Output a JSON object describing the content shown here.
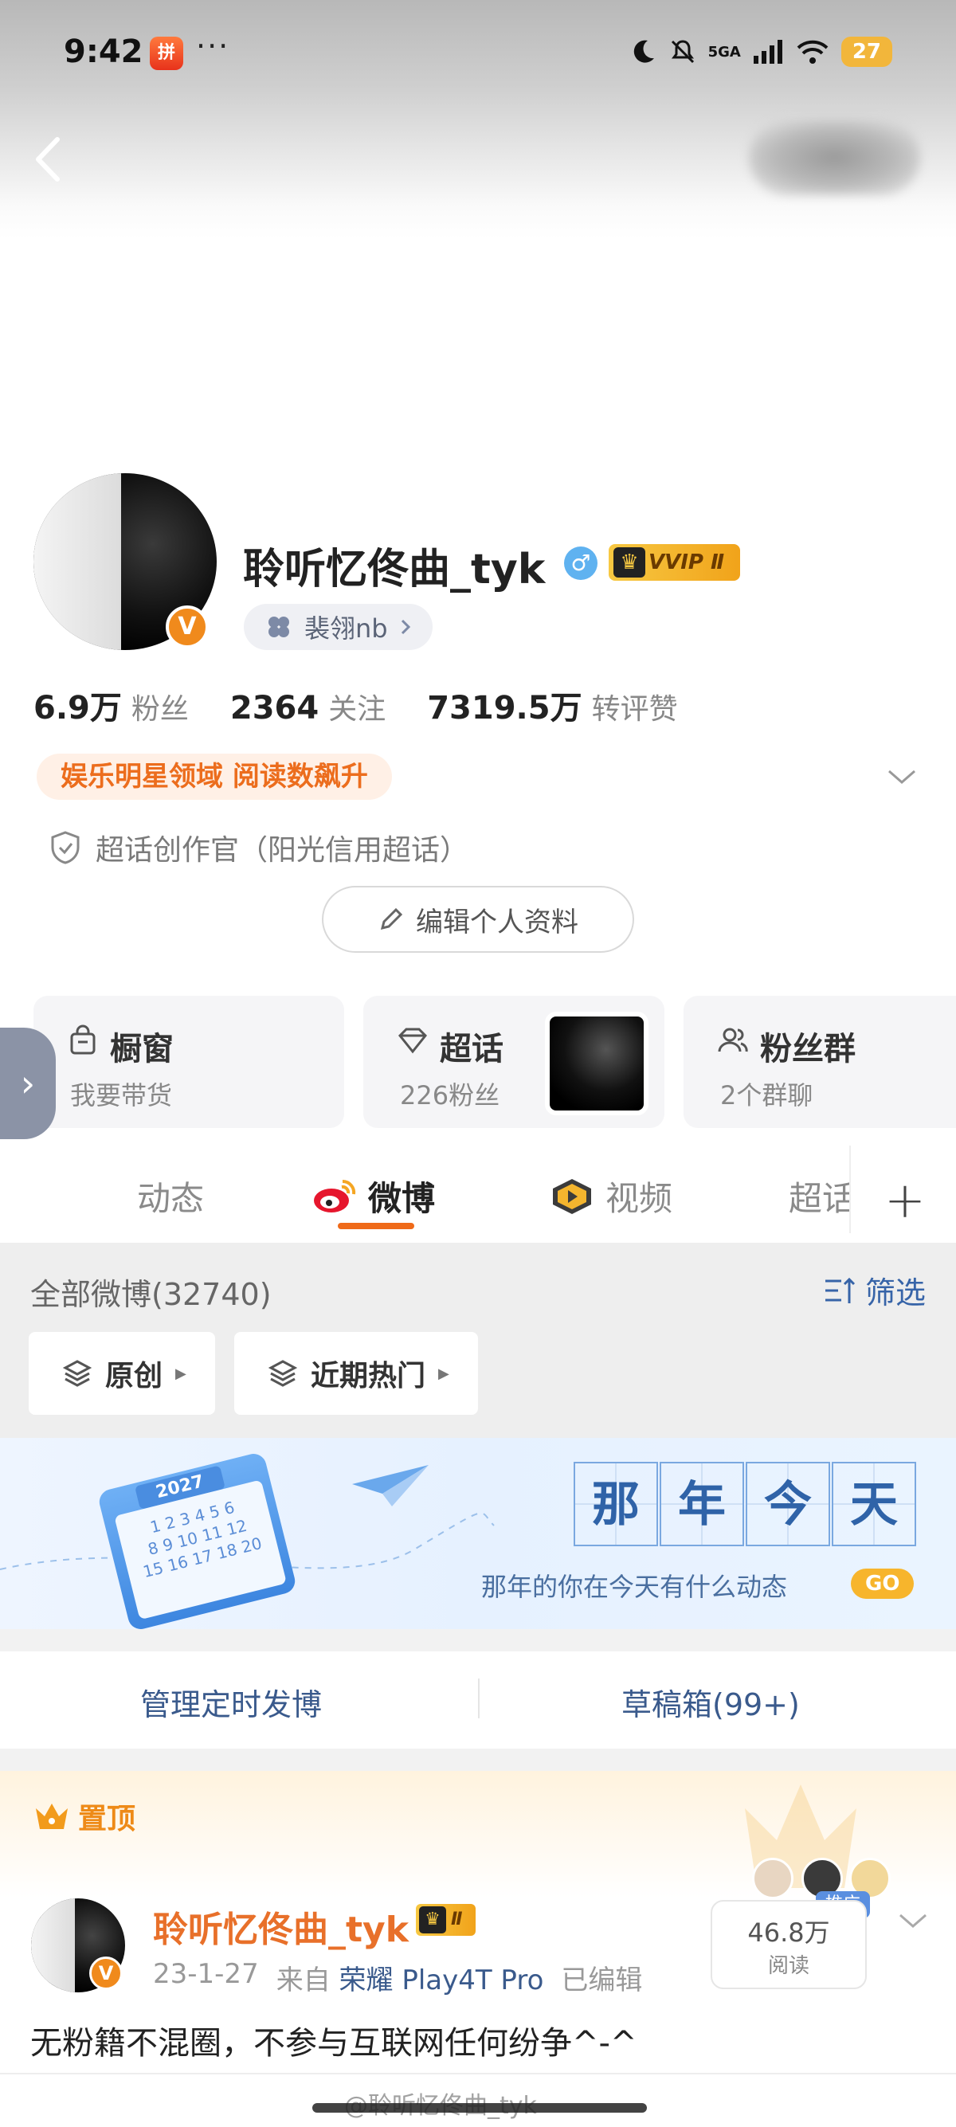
{
  "status_bar": {
    "time": "9:42",
    "app_icon_text": "拼",
    "more": "···",
    "network": "5GA",
    "battery": "27"
  },
  "profile": {
    "username": "聆听忆佟曲_tyk",
    "gender_icon": "♂",
    "vip_label": "VVIP Ⅱ",
    "tag": "裴翎nb",
    "stats": [
      {
        "num": "6.9万",
        "label": "粉丝"
      },
      {
        "num": "2364",
        "label": "关注"
      },
      {
        "num": "7319.5万",
        "label": "转评赞"
      }
    ],
    "domain_badge": "娱乐明星领域 阅读数飙升",
    "supertopic_role": "超话创作官（阳光信用超话）",
    "edit_button": "编辑个人资料"
  },
  "cards": [
    {
      "title": "橱窗",
      "sub": "我要带货"
    },
    {
      "title": "超话",
      "sub": "226粉丝"
    },
    {
      "title": "粉丝群",
      "sub": "2个群聊"
    }
  ],
  "tabs": [
    "动态",
    "微博",
    "视频",
    "超话"
  ],
  "active_tab": "微博",
  "feed": {
    "all_label": "全部微博(32740)",
    "filter_label": "筛选",
    "chips": [
      "原创",
      "近期热门"
    ]
  },
  "banner": {
    "chars": [
      "那",
      "年",
      "今",
      "天"
    ],
    "subtitle": "那年的你在今天有什么动态",
    "go": "GO",
    "calendar_year": "2027"
  },
  "actions": {
    "scheduled": "管理定时发博",
    "drafts": "草稿箱(99+)"
  },
  "pinned_post": {
    "pinned_label": "置顶",
    "author": "聆听忆佟曲_tyk",
    "vip": "Ⅱ",
    "date": "23-1-27",
    "source_prefix": "来自",
    "device": "荣耀 Play4T Pro",
    "edited": "已编辑",
    "reads": "46.8万",
    "reads_label": "阅读",
    "promo": "推广",
    "text": "无粉籍不混圈，不参与互联网任何纷争^-^"
  },
  "watermark": "@聆听忆佟曲_tyk",
  "colors": {
    "accent_orange": "#ef6a19",
    "link_blue": "#3a5a8c",
    "vip_gold": "#f1a31a"
  }
}
